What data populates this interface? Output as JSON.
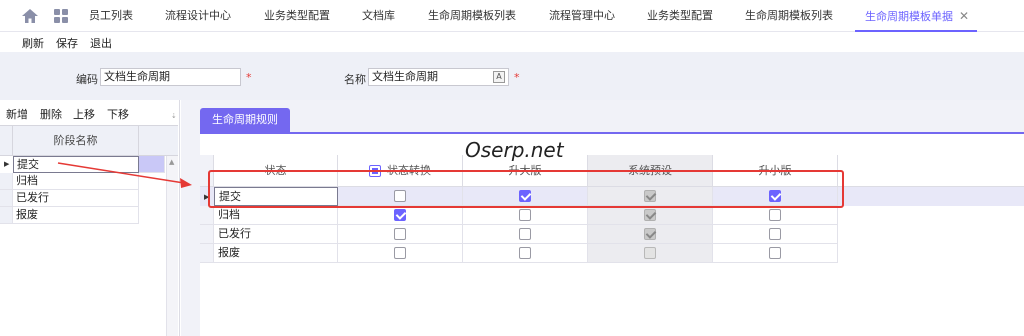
{
  "tabs": [
    {
      "label": "员工列表"
    },
    {
      "label": "流程设计中心"
    },
    {
      "label": "业务类型配置"
    },
    {
      "label": "文档库"
    },
    {
      "label": "生命周期模板列表"
    },
    {
      "label": "流程管理中心"
    },
    {
      "label": "业务类型配置"
    },
    {
      "label": "生命周期模板列表"
    },
    {
      "label": "生命周期模板单据",
      "active": true
    }
  ],
  "toolbar": {
    "refresh": "刷新",
    "save": "保存",
    "exit": "退出"
  },
  "form": {
    "code_label": "编码",
    "code_value": "文档生命周期",
    "name_label": "名称",
    "name_value": "文档生命周期",
    "required_mark": "*"
  },
  "left": {
    "tools": {
      "add": "新增",
      "delete": "删除",
      "up": "上移",
      "down": "下移"
    },
    "column_header": "阶段名称",
    "rows": [
      "提交",
      "归档",
      "已发行",
      "报废"
    ]
  },
  "right": {
    "section_tab": "生命周期规则",
    "watermark": "Oserp.net",
    "columns": [
      "状态",
      "状态转换",
      "升大版",
      "系统预设",
      "升小版"
    ],
    "rows": [
      {
        "state": "提交",
        "transition": false,
        "major": true,
        "preset": true,
        "minor": true
      },
      {
        "state": "归档",
        "transition": true,
        "major": false,
        "preset": true,
        "minor": false
      },
      {
        "state": "已发行",
        "transition": false,
        "major": false,
        "preset": true,
        "minor": false
      },
      {
        "state": "报废",
        "transition": false,
        "major": false,
        "preset": false,
        "minor": false
      }
    ]
  },
  "colors": {
    "accent": "#6c63ff",
    "annotation": "#e53935"
  }
}
